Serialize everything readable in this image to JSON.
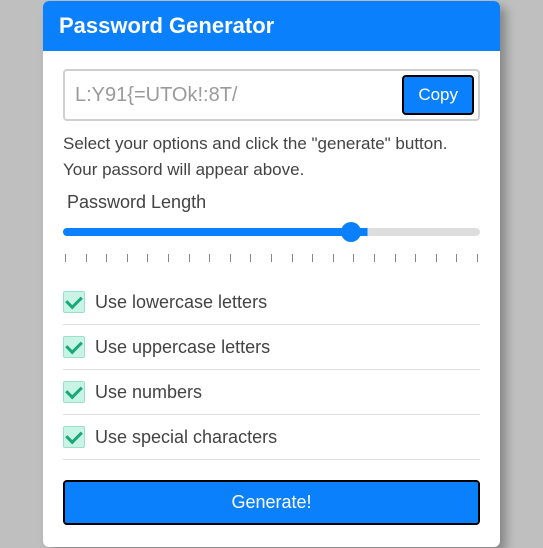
{
  "header": {
    "title": "Password Generator"
  },
  "output": {
    "value": "L:Y91{=UTOk!:8T/",
    "copy_label": "Copy"
  },
  "instructions": "Select your options and click the \"generate\" button. Your passord will appear above.",
  "length": {
    "label": "Password Length",
    "min": 2,
    "max": 22,
    "value": 16
  },
  "options": [
    {
      "key": "lowercase",
      "label": "Use lowercase letters",
      "checked": true
    },
    {
      "key": "uppercase",
      "label": "Use uppercase letters",
      "checked": true
    },
    {
      "key": "numbers",
      "label": "Use numbers",
      "checked": true
    },
    {
      "key": "special",
      "label": "Use special characters",
      "checked": true
    }
  ],
  "generate_label": "Generate!"
}
